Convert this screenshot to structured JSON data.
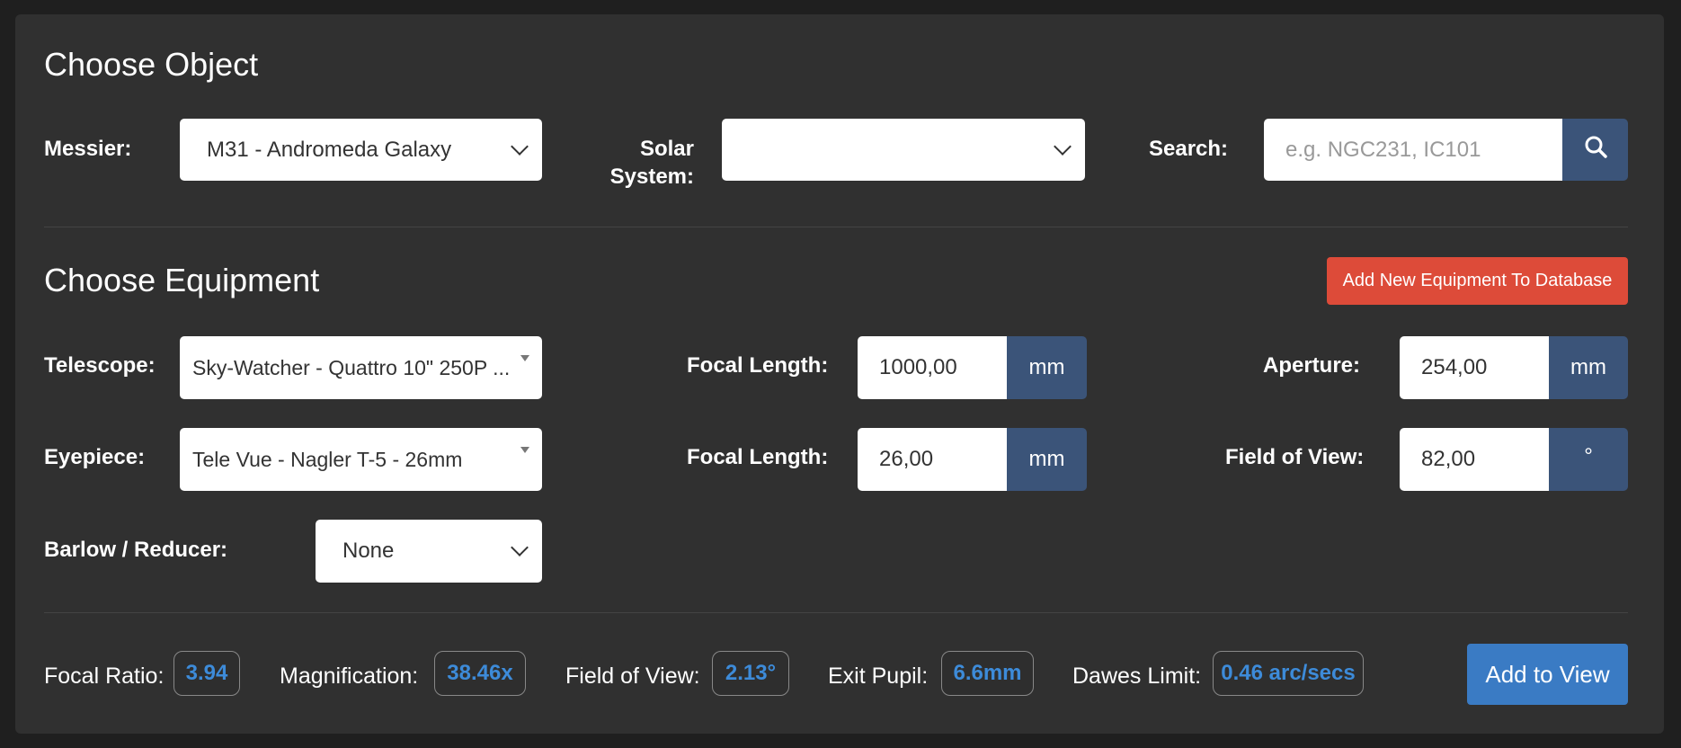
{
  "choose_object": {
    "title": "Choose Object",
    "messier_label": "Messier:",
    "messier_value": "M31 - Andromeda Galaxy",
    "solar_label_1": "Solar",
    "solar_label_2": "System:",
    "solar_value": "",
    "search_label": "Search:",
    "search_placeholder": "e.g. NGC231, IC101",
    "search_value": ""
  },
  "choose_equipment": {
    "title": "Choose Equipment",
    "add_button": "Add New Equipment To Database",
    "telescope_label": "Telescope:",
    "telescope_value": "Sky-Watcher - Quattro 10\" 250P ...",
    "telescope_focal_label": "Focal Length:",
    "telescope_focal_value": "1000,00",
    "telescope_focal_unit": "mm",
    "aperture_label": "Aperture:",
    "aperture_value": "254,00",
    "aperture_unit": "mm",
    "eyepiece_label": "Eyepiece:",
    "eyepiece_value": "Tele Vue - Nagler T-5 - 26mm",
    "eyepiece_focal_label": "Focal Length:",
    "eyepiece_focal_value": "26,00",
    "eyepiece_focal_unit": "mm",
    "fov_label": "Field of View:",
    "fov_value": "82,00",
    "fov_unit": "°",
    "barlow_label": "Barlow / Reducer:",
    "barlow_value": "None"
  },
  "results": {
    "focal_ratio_label": "Focal Ratio:",
    "focal_ratio_value": "3.94",
    "magnification_label": "Magnification:",
    "magnification_value": "38.46x",
    "fov_label": "Field of View:",
    "fov_value": "2.13°",
    "exit_pupil_label": "Exit Pupil:",
    "exit_pupil_value": "6.6mm",
    "dawes_label": "Dawes Limit:",
    "dawes_value": "0.46 arc/secs",
    "add_to_view": "Add to View"
  },
  "colors": {
    "panel": "#303030",
    "addon": "#3b5479",
    "danger": "#dd4b39",
    "primary": "#3a7bc4",
    "badge_text": "#3d8bd9"
  },
  "icons": {
    "search": "search-icon"
  }
}
